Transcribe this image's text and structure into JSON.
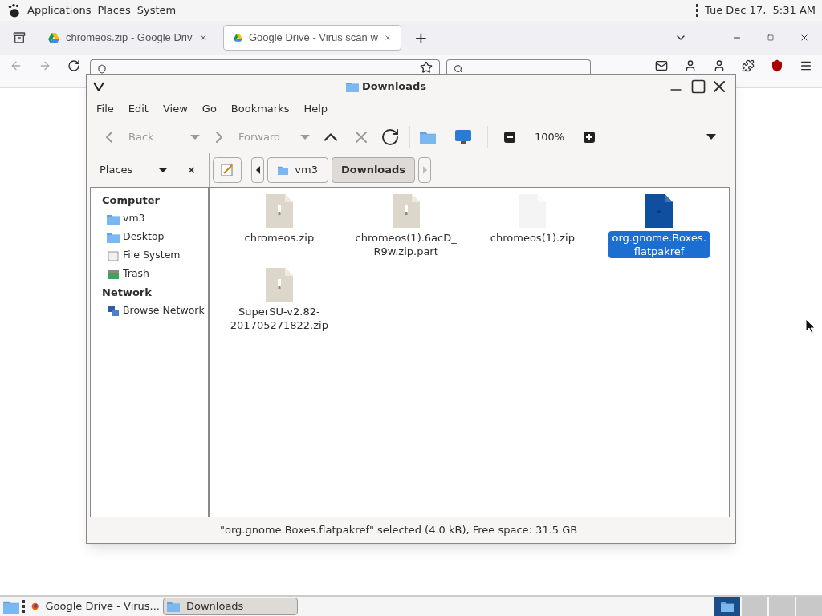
{
  "top_panel": {
    "menus": [
      "Applications",
      "Places",
      "System"
    ],
    "clock": "Tue Dec 17,  5:31 AM"
  },
  "browser": {
    "tabs": [
      {
        "title": "chromeos.zip - Google Driv",
        "selected": false
      },
      {
        "title": "Google Drive - Virus scan w",
        "selected": true
      }
    ],
    "new_tab": "+"
  },
  "file_manager": {
    "title": "Downloads",
    "menu": [
      "File",
      "Edit",
      "View",
      "Go",
      "Bookmarks",
      "Help"
    ],
    "toolbar": {
      "back": {
        "label": "Back",
        "disabled": true
      },
      "forward": {
        "label": "Forward",
        "disabled": true
      },
      "zoom": "100%"
    },
    "places": {
      "label": "Places",
      "close": "×"
    },
    "path": [
      {
        "label": "vm3",
        "selected": false
      },
      {
        "label": "Downloads",
        "selected": true
      }
    ],
    "sidebar": [
      {
        "heading": "Computer",
        "items": [
          {
            "label": "vm3",
            "kind": "home"
          },
          {
            "label": "Desktop",
            "kind": "desktop"
          },
          {
            "label": "File System",
            "kind": "drive"
          },
          {
            "label": "Trash",
            "kind": "trash"
          }
        ]
      },
      {
        "heading": "Network",
        "items": [
          {
            "label": "Browse Network",
            "kind": "network"
          }
        ]
      }
    ],
    "files": [
      {
        "name": "chromeos.zip",
        "kind": "zip",
        "selected": false
      },
      {
        "name": "chromeos(1).6acD_\nR9w.zip.part",
        "kind": "zip",
        "selected": false
      },
      {
        "name": "chromeos(1).zip",
        "kind": "blank",
        "selected": false
      },
      {
        "name": "org.gnome.Boxes.\nflatpakref",
        "kind": "package",
        "selected": true
      },
      {
        "name": "SuperSU-v2.82-\n201705271822.zip",
        "kind": "zip",
        "selected": false
      }
    ],
    "status": "\"org.gnome.Boxes.flatpakref\" selected (4.0 kB), Free space: 31.5 GB"
  },
  "taskbar": {
    "windows": [
      {
        "title": "Google Drive - Virus...",
        "kind": "browser",
        "selected": false
      },
      {
        "title": "Downloads",
        "kind": "folder",
        "selected": true
      }
    ],
    "workspaces": [
      {
        "selected": true
      },
      {
        "selected": false
      },
      {
        "selected": false
      },
      {
        "selected": false
      }
    ]
  }
}
